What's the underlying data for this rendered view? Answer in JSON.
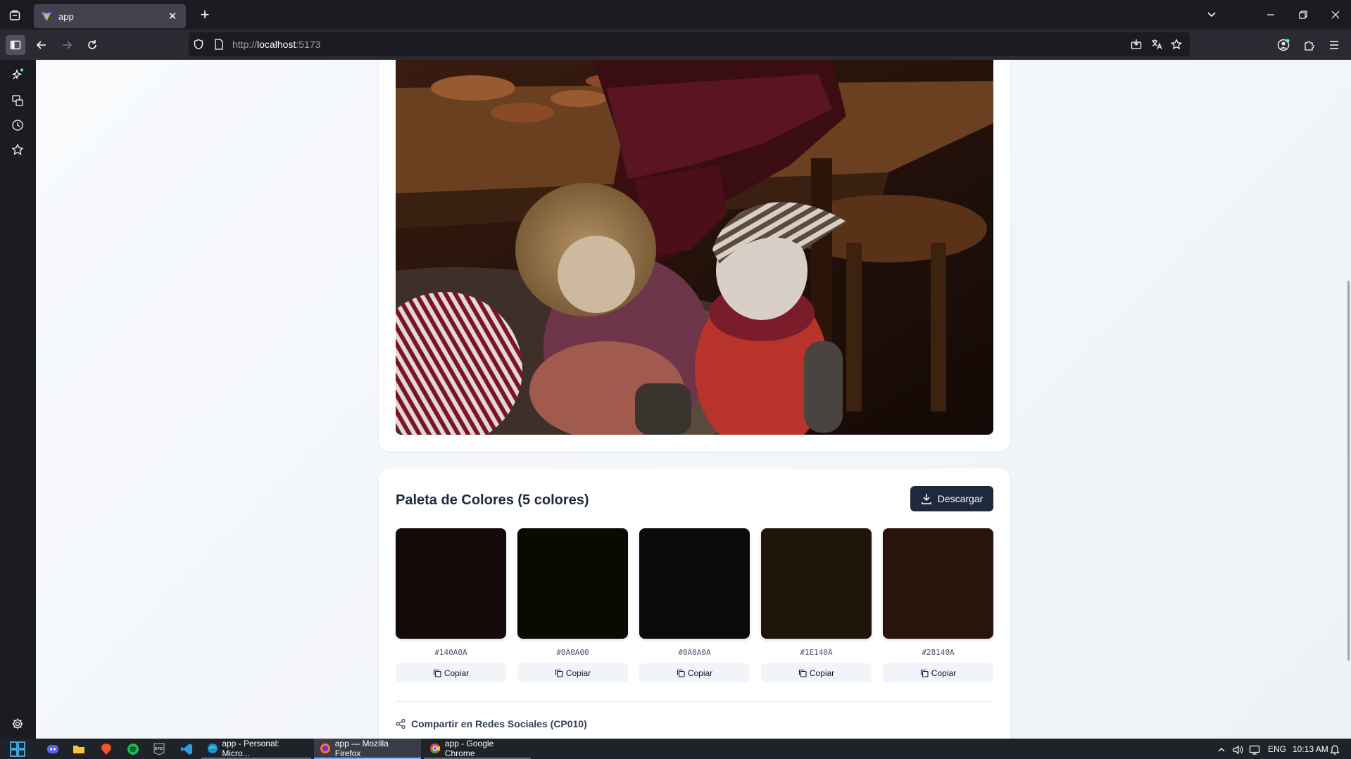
{
  "browser": {
    "tab_title": "app",
    "url_prefix": "http://",
    "url_host": "localhost",
    "url_suffix": ":5173"
  },
  "palette": {
    "title": "Paleta de Colores (5 colores)",
    "download_label": "Descargar",
    "copy_label": "Copiar",
    "swatches": [
      {
        "hex": "#140A0A"
      },
      {
        "hex": "#0A0A00"
      },
      {
        "hex": "#0A0A0A"
      },
      {
        "hex": "#1E140A"
      },
      {
        "hex": "#28140A"
      }
    ],
    "share_label": "Compartir en Redes Sociales (CP010)"
  },
  "taskbar": {
    "apps": [
      {
        "label": "app - Personal: Micro...",
        "state": "open"
      },
      {
        "label": "app — Mozilla Firefox",
        "state": "active"
      },
      {
        "label": "app - Google Chrome",
        "state": "open"
      }
    ],
    "language": "ENG",
    "time": "10:13 AM"
  }
}
